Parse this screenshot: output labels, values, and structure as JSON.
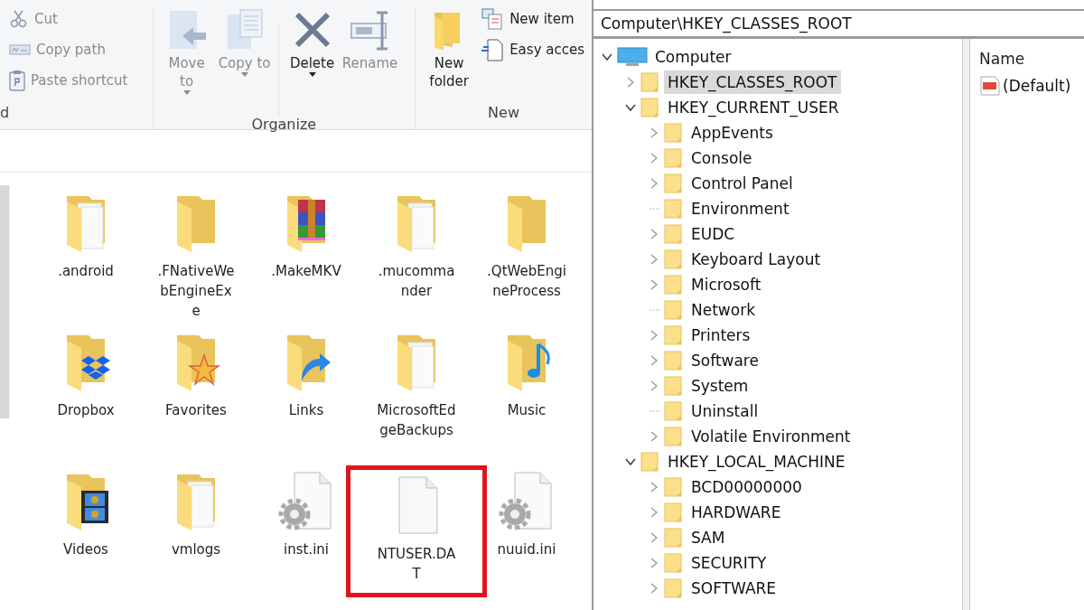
{
  "explorer": {
    "ribbon": {
      "groups": [
        {
          "label": "d",
          "items": [
            {
              "label": "Cut",
              "kind": "small",
              "disabled": true
            },
            {
              "label": "Copy path",
              "kind": "small",
              "disabled": true
            },
            {
              "label": "Paste shortcut",
              "kind": "small",
              "disabled": true
            }
          ]
        },
        {
          "label": "Organize",
          "items": [
            {
              "label": "Move to",
              "kind": "large",
              "disabled": true,
              "dropdown": true
            },
            {
              "label": "Copy to",
              "kind": "large",
              "disabled": true,
              "dropdown": true
            },
            {
              "label": "Delete",
              "kind": "large",
              "disabled": false,
              "dropdown": true,
              "separator_before": true
            },
            {
              "label": "Rename",
              "kind": "large",
              "disabled": true
            }
          ]
        },
        {
          "label": "New",
          "items": [
            {
              "label": "New folder",
              "kind": "large",
              "disabled": false
            },
            {
              "label": "New item",
              "kind": "small",
              "disabled": false
            },
            {
              "label": "Easy acces",
              "kind": "small",
              "disabled": false
            }
          ]
        }
      ]
    },
    "files": [
      {
        "name": ".android",
        "kind": "folder-files",
        "highlighted": false
      },
      {
        "name": ".FNativeWebEngineExe",
        "kind": "folder",
        "highlighted": false
      },
      {
        "name": ".MakeMKV",
        "kind": "folder-archive",
        "highlighted": false
      },
      {
        "name": ".mucommander",
        "kind": "folder-files",
        "highlighted": false
      },
      {
        "name": ".QtWebEngineProcess",
        "kind": "folder",
        "highlighted": false
      },
      {
        "name": "Dropbox",
        "kind": "folder-dropbox",
        "highlighted": false
      },
      {
        "name": "Favorites",
        "kind": "folder-star",
        "highlighted": false
      },
      {
        "name": "Links",
        "kind": "folder-link",
        "highlighted": false
      },
      {
        "name": "MicrosoftEdgeBackups",
        "kind": "folder-files",
        "highlighted": false
      },
      {
        "name": "Music",
        "kind": "folder-music",
        "highlighted": false
      },
      {
        "name": "Videos",
        "kind": "folder-video",
        "highlighted": false
      },
      {
        "name": "vmlogs",
        "kind": "folder-files",
        "highlighted": false
      },
      {
        "name": "inst.ini",
        "kind": "settings-file",
        "highlighted": false
      },
      {
        "name": "NTUSER.DAT",
        "kind": "file",
        "highlighted": true
      },
      {
        "name": "nuuid.ini",
        "kind": "settings-file",
        "highlighted": false
      }
    ]
  },
  "registry": {
    "address": "Computer\\HKEY_CLASSES_ROOT",
    "tree": [
      {
        "label": "Computer",
        "kind": "computer",
        "expandable": true,
        "expanded": true,
        "selected": false,
        "children": [
          {
            "label": "HKEY_CLASSES_ROOT",
            "kind": "key",
            "expandable": true,
            "expanded": false,
            "selected": true
          },
          {
            "label": "HKEY_CURRENT_USER",
            "kind": "key",
            "expandable": true,
            "expanded": true,
            "selected": false,
            "children": [
              {
                "label": "AppEvents",
                "kind": "key",
                "expandable": true,
                "expanded": false,
                "selected": false
              },
              {
                "label": "Console",
                "kind": "key",
                "expandable": true,
                "expanded": false,
                "selected": false
              },
              {
                "label": "Control Panel",
                "kind": "key",
                "expandable": true,
                "expanded": false,
                "selected": false
              },
              {
                "label": "Environment",
                "kind": "key",
                "expandable": false,
                "selected": false
              },
              {
                "label": "EUDC",
                "kind": "key",
                "expandable": true,
                "expanded": false,
                "selected": false
              },
              {
                "label": "Keyboard Layout",
                "kind": "key",
                "expandable": true,
                "expanded": false,
                "selected": false
              },
              {
                "label": "Microsoft",
                "kind": "key",
                "expandable": true,
                "expanded": false,
                "selected": false
              },
              {
                "label": "Network",
                "kind": "key",
                "expandable": false,
                "selected": false
              },
              {
                "label": "Printers",
                "kind": "key",
                "expandable": true,
                "expanded": false,
                "selected": false
              },
              {
                "label": "Software",
                "kind": "key",
                "expandable": true,
                "expanded": false,
                "selected": false
              },
              {
                "label": "System",
                "kind": "key",
                "expandable": true,
                "expanded": false,
                "selected": false
              },
              {
                "label": "Uninstall",
                "kind": "key",
                "expandable": false,
                "selected": false
              },
              {
                "label": "Volatile Environment",
                "kind": "key",
                "expandable": true,
                "expanded": false,
                "selected": false
              }
            ]
          },
          {
            "label": "HKEY_LOCAL_MACHINE",
            "kind": "key",
            "expandable": true,
            "expanded": true,
            "selected": false,
            "children": [
              {
                "label": "BCD00000000",
                "kind": "key",
                "expandable": true,
                "expanded": false,
                "selected": false
              },
              {
                "label": "HARDWARE",
                "kind": "key",
                "expandable": true,
                "expanded": false,
                "selected": false
              },
              {
                "label": "SAM",
                "kind": "key",
                "expandable": true,
                "expanded": false,
                "selected": false
              },
              {
                "label": "SECURITY",
                "kind": "key",
                "expandable": true,
                "expanded": false,
                "selected": false
              },
              {
                "label": "SOFTWARE",
                "kind": "key",
                "expandable": true,
                "expanded": false,
                "selected": false
              }
            ]
          }
        ]
      }
    ],
    "values": {
      "column": "Name",
      "rows": [
        {
          "name": "(Default)",
          "kind": "string"
        }
      ]
    }
  }
}
